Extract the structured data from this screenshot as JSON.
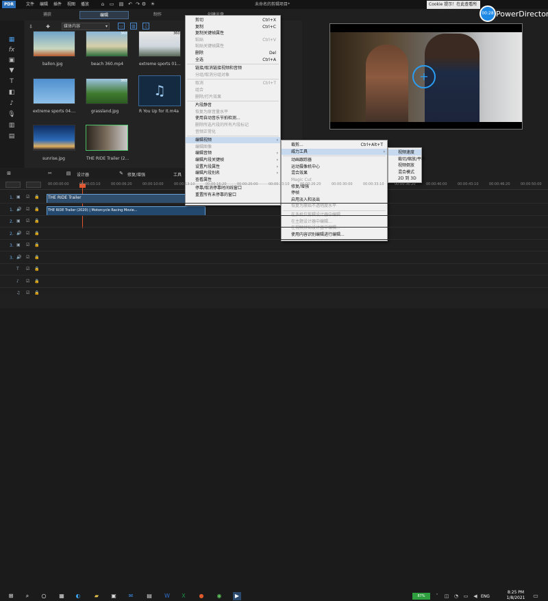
{
  "titlebar": {
    "logo": "PDR",
    "menus": [
      "文件",
      "编辑",
      "插件",
      "视图",
      "播放"
    ],
    "doc_title": "未命名的剪辑项目*",
    "notification": "Cookie 提示！在此查看所有的缓存与版图",
    "badge": "00:28",
    "app_name": "PowerDirector"
  },
  "mode_tabs": {
    "capture": "捕获",
    "edit": "编辑",
    "produce": "制作",
    "disc": "创建光盘"
  },
  "library": {
    "filter": "媒体内容",
    "items": [
      {
        "caption": "ballon.jpg"
      },
      {
        "caption": "beach 360.mp4",
        "badge": "360"
      },
      {
        "caption": "extreme sports 01...",
        "badge": "360"
      },
      {
        "caption": "extreme sports 04...."
      },
      {
        "caption": "grassland.jpg",
        "badge": "360"
      },
      {
        "caption": "R You Up for It.m4a"
      },
      {
        "caption": "sunrise.jpg"
      },
      {
        "caption": "THE RIDE Trailer (2..."
      }
    ]
  },
  "timeline": {
    "tools": {
      "designer": "设计器",
      "fix": "修复/增强",
      "tools": "工具"
    },
    "ruler": [
      "00:00:00:00",
      "00:00:03:10",
      "00:00:06:20",
      "00:00:10:00",
      "00:00:13:10",
      "00:00:16:20",
      "00:00:20:00",
      "00:00:23:10",
      "00:00:26:20",
      "00:00:30:00",
      "00:00:33:10",
      "00:00:36:20",
      "00:00:40:00",
      "00:00:43:10",
      "00:00:46:20",
      "00:00:50:00"
    ],
    "tracks": [
      "1.",
      "1.",
      "2.",
      "2.",
      "3.",
      "3.",
      "",
      "",
      ""
    ],
    "video_clip": "THE RIDE Trailer",
    "audio_clip": "THE RIDE Trailer (2020) | Motorcycle Racing Movie..."
  },
  "context_menu": {
    "items": [
      {
        "label": "剪切",
        "shortcut": "Ctrl+X"
      },
      {
        "label": "复制",
        "shortcut": "Ctrl+C"
      },
      {
        "label": "复制关键帧属性"
      },
      {
        "label": "粘贴",
        "shortcut": "Ctrl+V",
        "disabled": true
      },
      {
        "label": "粘贴关键帧属性",
        "disabled": true
      },
      {
        "label": "删除",
        "shortcut": "Del"
      },
      {
        "label": "全选",
        "shortcut": "Ctrl+A"
      },
      {
        "label": "链接/取消链接视频和音频"
      },
      {
        "label": "分组/取消分组对象",
        "disabled": true
      },
      {
        "label": "取消",
        "shortcut": "Ctrl+T",
        "disabled": true
      },
      {
        "label": "组合",
        "disabled": true
      },
      {
        "label": "删除/打片效果",
        "disabled": true
      },
      {
        "label": "片段静音"
      },
      {
        "label": "恢复为原音量水平",
        "disabled": true
      },
      {
        "label": "使用自动音乐节拍检测..."
      },
      {
        "label": "删除所选片段的所有片段标记",
        "disabled": true
      },
      {
        "label": "音频正常化",
        "disabled": true
      },
      {
        "label": "编辑视频",
        "submenu": true,
        "selected": true
      },
      {
        "label": "编辑图像",
        "disabled": true
      },
      {
        "label": "编辑音频",
        "submenu": true
      },
      {
        "label": "编辑片段关键帧",
        "submenu": true
      },
      {
        "label": "设置片段属性",
        "submenu": true
      },
      {
        "label": "编辑片段别名",
        "submenu": true
      },
      {
        "label": "查看属性"
      },
      {
        "label": "停靠/取消停靠时间线窗口"
      },
      {
        "label": "重置所有未停靠的窗口"
      }
    ]
  },
  "submenu_edit_video": {
    "items": [
      {
        "label": "裁剪...",
        "shortcut": "Ctrl+Alt+T"
      },
      {
        "label": "威力工具",
        "submenu": true,
        "selected": true
      },
      {
        "label": "动画跟踪器"
      },
      {
        "label": "运动摄像机中心"
      },
      {
        "label": "混合效果"
      },
      {
        "label": "Magic Cut",
        "disabled": true
      },
      {
        "label": "修复/增强"
      },
      {
        "label": "停帧"
      },
      {
        "label": "启用淡入和淡出"
      },
      {
        "label": "恢复为原始不透明度水平",
        "disabled": true
      },
      {
        "label": "在多机位剪辑设计器中编辑...",
        "disabled": true
      },
      {
        "label": "在主题设计器中编辑...",
        "disabled": true
      },
      {
        "label": "在视频拼贴设计器中编辑...",
        "disabled": true
      },
      {
        "label": "使用内容识别编辑进行编辑..."
      }
    ]
  },
  "submenu_power_tools": {
    "items": [
      {
        "label": "视频速度",
        "selected": true
      },
      {
        "label": "裁切/缩放/平移"
      },
      {
        "label": "视频倒放"
      },
      {
        "label": "混合模式"
      },
      {
        "label": "2D 到 3D"
      }
    ]
  },
  "taskbar": {
    "battery": "87%",
    "lang": "ENG",
    "time": "8:25 PM",
    "date": "1/8/2021"
  }
}
